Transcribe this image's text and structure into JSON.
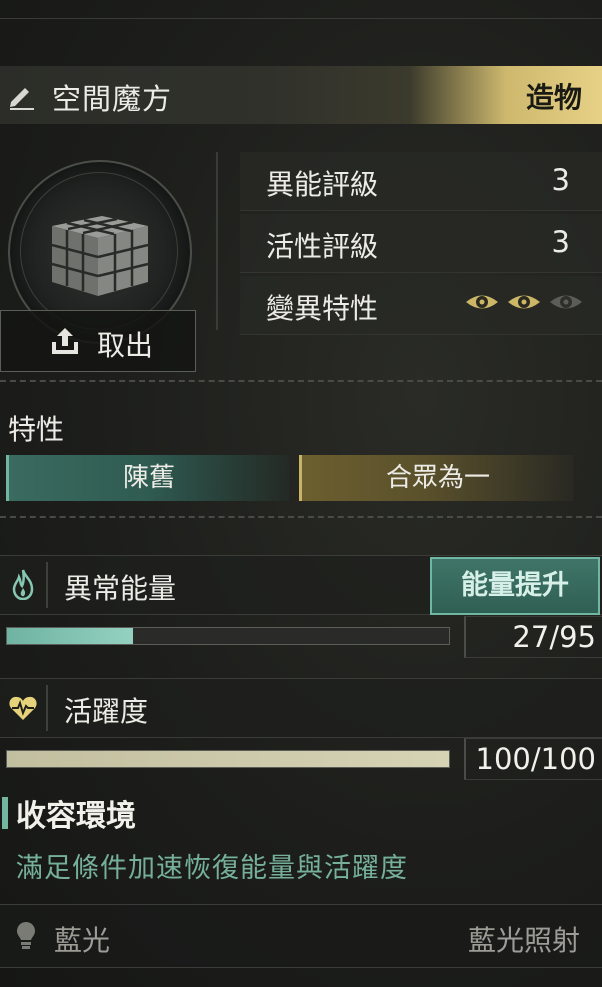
{
  "item": {
    "name": "空間魔方",
    "type_tag": "造物",
    "take_out_label": "取出"
  },
  "stats": [
    {
      "label": "異能評級",
      "value": "3"
    },
    {
      "label": "活性評級",
      "value": "3"
    },
    {
      "label": "變異特性",
      "eyes_active": 2,
      "eyes_total": 3
    }
  ],
  "traits": {
    "section_label": "特性",
    "items": [
      "陳舊",
      "合眾為一"
    ]
  },
  "energy": {
    "label": "異常能量",
    "boost_label": "能量提升",
    "value_text": "27/95",
    "current": 27,
    "max": 95
  },
  "activity": {
    "label": "活躍度",
    "value_text": "100/100",
    "current": 100,
    "max": 100
  },
  "environment": {
    "title": "收容環境",
    "description": "滿足條件加速恢復能量與活躍度"
  },
  "light": {
    "label": "藍光",
    "value": "藍光照射"
  },
  "colors": {
    "accent_teal": "#73b5a0",
    "accent_gold": "#d9c47a"
  }
}
